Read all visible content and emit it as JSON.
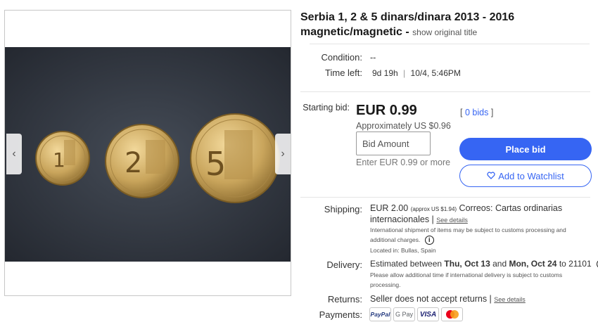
{
  "item": {
    "title": "Serbia 1, 2 & 5 dinars/dinara 2013 - 2016 magnetic/magnetic -",
    "show_original": "show original title"
  },
  "details": {
    "condition_label": "Condition:",
    "condition_value": "--",
    "time_left_label": "Time left:",
    "time_left_value": "9d 19h",
    "time_left_sep": "|",
    "end_time": "10/4, 5:46PM"
  },
  "bid": {
    "starting_label": "Starting bid:",
    "price": "EUR 0.99",
    "approx": "Approximately US $0.96",
    "bids_open": "[",
    "bids_count": "0 bids",
    "bids_close": "]",
    "input_placeholder": "Bid Amount",
    "enter_hint": "Enter EUR 0.99 or more",
    "place_bid": "Place bid",
    "watchlist": "Add to Watchlist"
  },
  "shipping": {
    "label": "Shipping:",
    "price": "EUR 2.00",
    "approx": "(approx US $1.94)",
    "service_line1": "Correos: Cartas ordinarias",
    "service_line2": "internacionales |",
    "see_details": "See details",
    "customs_line1": "International shipment of items may be subject to customs processing and",
    "customs_line2": "additional charges.",
    "location": "Located in: Bullas, Spain"
  },
  "delivery": {
    "label": "Delivery:",
    "prefix": "Estimated between",
    "date1": "Thu, Oct 13",
    "and": "and",
    "date2": "Mon, Oct 24",
    "to": "to 21101",
    "note_line1": "Please allow additional time if international delivery is subject to customs",
    "note_line2": "processing."
  },
  "returns": {
    "label": "Returns:",
    "value": "Seller does not accept returns |",
    "see_details": "See details"
  },
  "payments": {
    "label": "Payments:",
    "methods": [
      "PayPal",
      "G Pay",
      "VISA",
      "Mastercard"
    ]
  },
  "coins": {
    "coin1": "1",
    "coin2": "2",
    "coin3": "5"
  }
}
